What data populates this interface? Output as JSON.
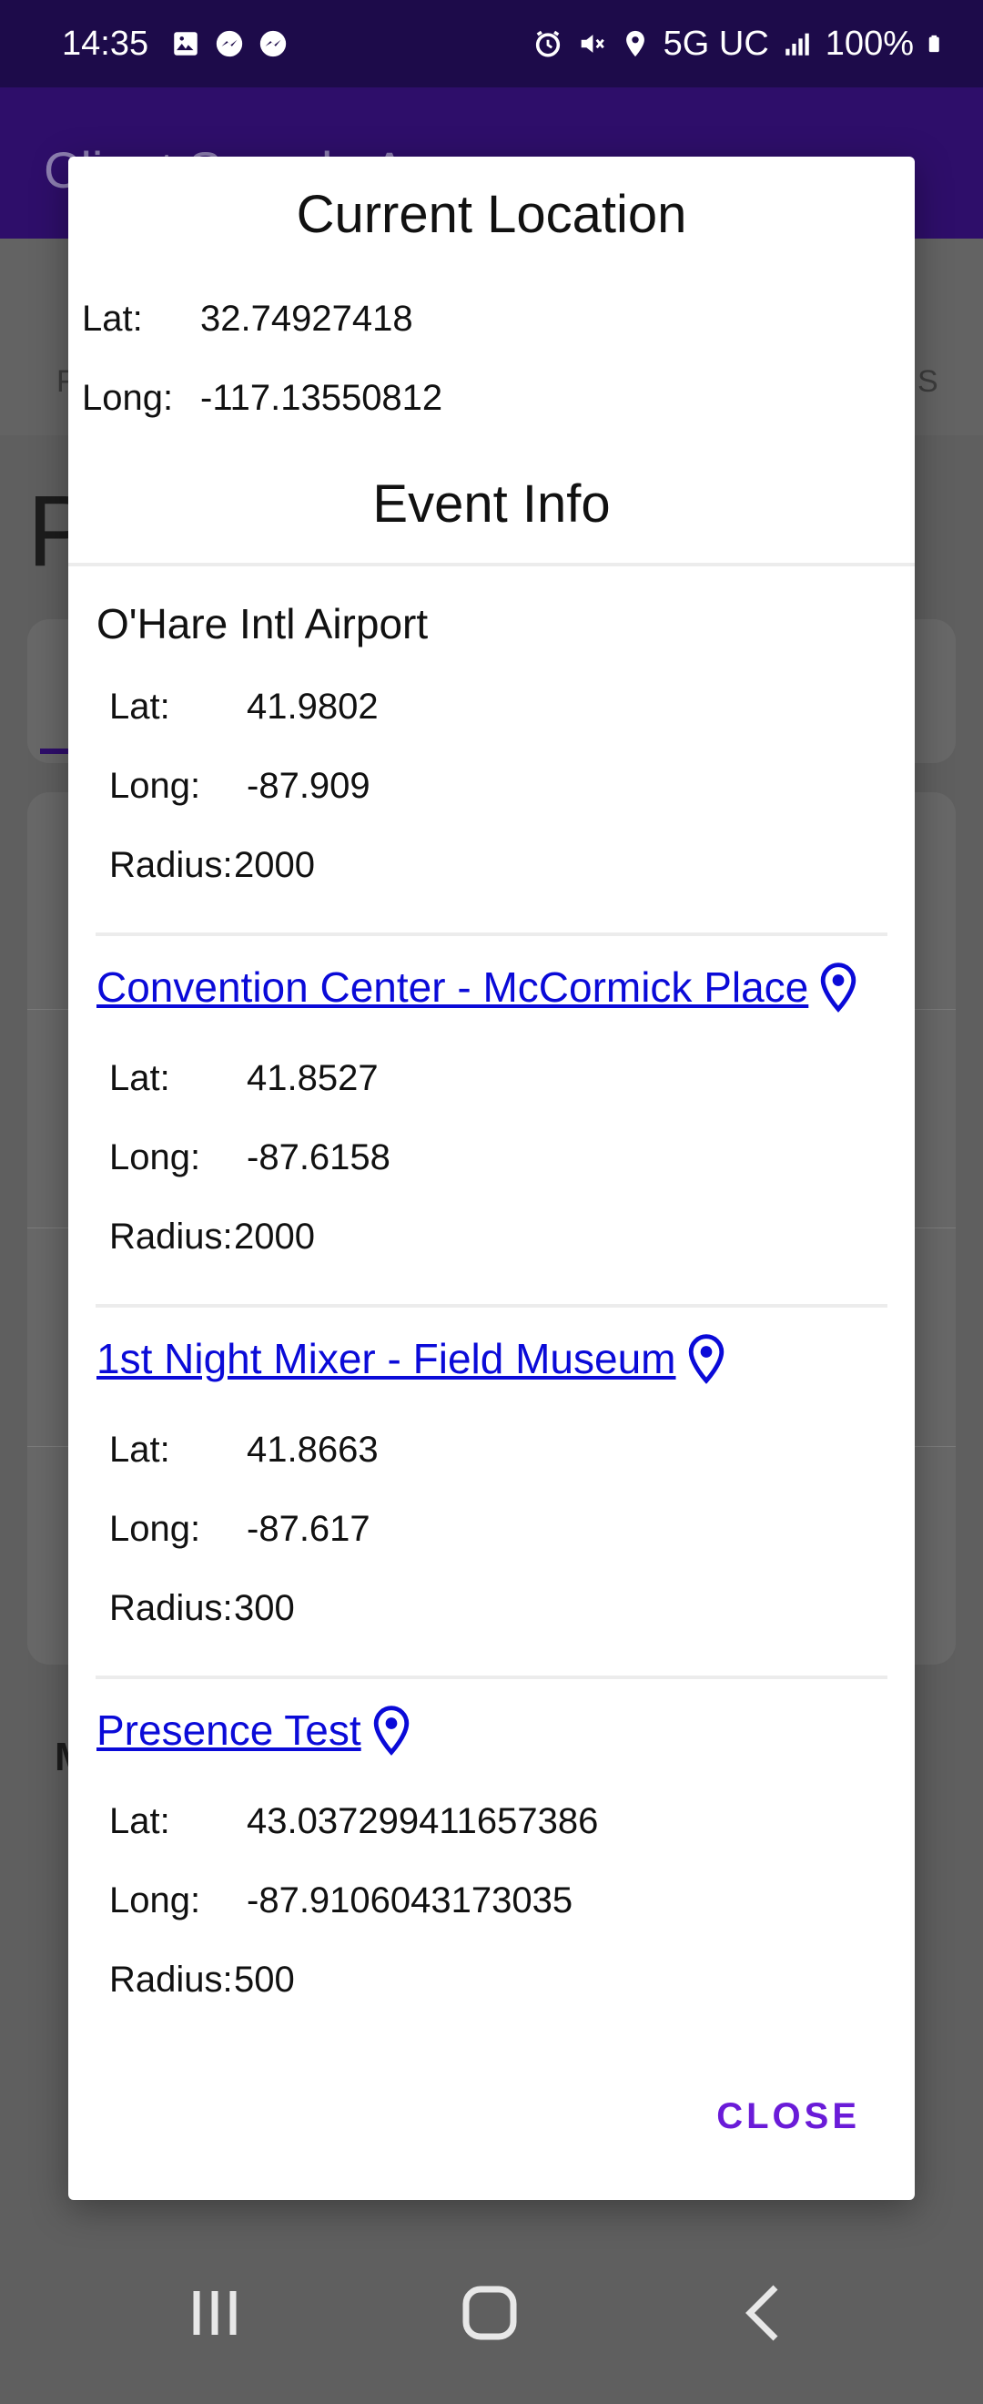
{
  "status_bar": {
    "time": "14:35",
    "left_icons": [
      "gallery-icon",
      "messenger-icon",
      "messenger-icon"
    ],
    "right_icons": [
      "alarm-icon",
      "mute-icon",
      "location-icon"
    ],
    "network": "5G UC",
    "battery": "100%"
  },
  "app_bar": {
    "title": "Client Sample App"
  },
  "background": {
    "tab_left": "F",
    "tab_right": "S",
    "page_title_fragment": "P",
    "section_letter": "M"
  },
  "dialog": {
    "title": "Current Location",
    "current": {
      "lat_label": "Lat:",
      "lat_value": "32.74927418",
      "long_label": "Long:",
      "long_value": "-117.13550812"
    },
    "events_title": "Event Info",
    "events": [
      {
        "name": "O'Hare Intl Airport",
        "is_link": false,
        "lat_label": "Lat:",
        "lat": "41.9802",
        "long_label": "Long:",
        "long": "-87.909",
        "radius_label": "Radius:",
        "radius": "2000"
      },
      {
        "name": "Convention Center - McCormick Place",
        "is_link": true,
        "lat_label": "Lat:",
        "lat": "41.8527",
        "long_label": "Long:",
        "long": "-87.6158",
        "radius_label": "Radius:",
        "radius": "2000"
      },
      {
        "name": "1st Night Mixer - Field Museum",
        "is_link": true,
        "lat_label": "Lat:",
        "lat": "41.8663",
        "long_label": "Long:",
        "long": "-87.617",
        "radius_label": "Radius:",
        "radius": "300"
      },
      {
        "name": "Presence Test",
        "is_link": true,
        "lat_label": "Lat:",
        "lat": "43.037299411657386",
        "long_label": "Long:",
        "long": "-87.9106043173035",
        "radius_label": "Radius:",
        "radius": "500"
      }
    ],
    "close_label": "CLOSE"
  },
  "colors": {
    "status_bar": "#1d0b4a",
    "app_bar": "#2e0e6a",
    "link": "#0a0ad8",
    "accent": "#6a1bd8"
  }
}
